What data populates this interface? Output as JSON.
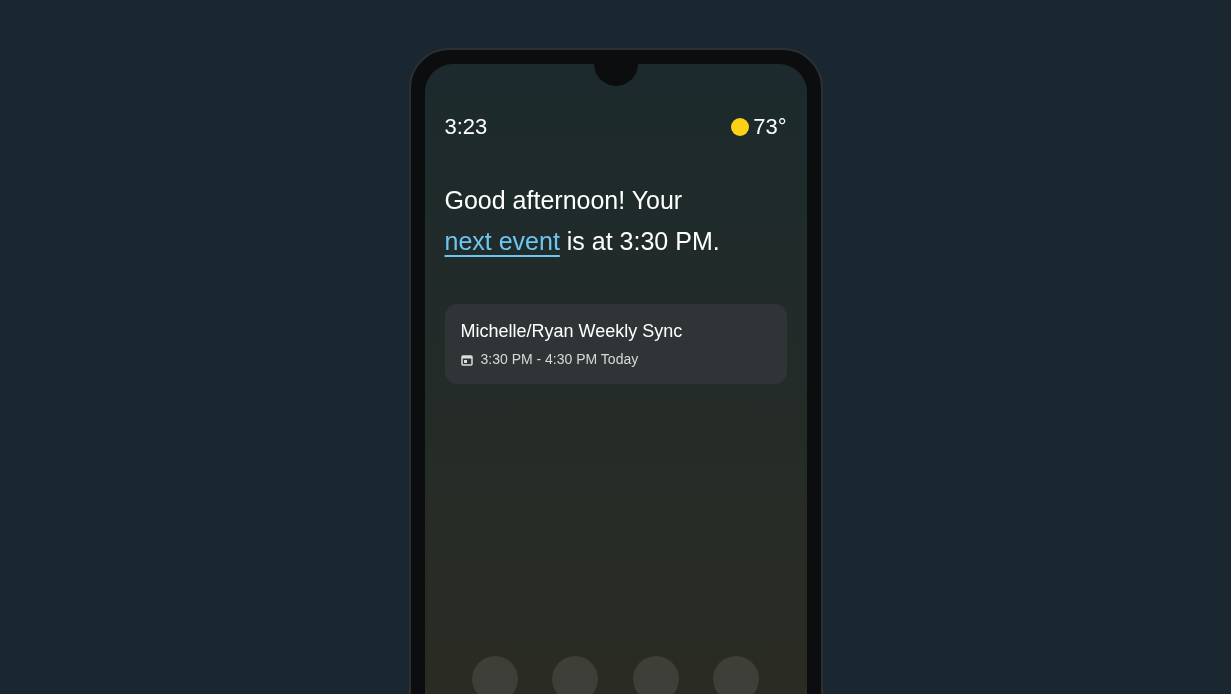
{
  "status": {
    "time": "3:23",
    "temperature": "73°"
  },
  "greeting": {
    "before": "Good afternoon! Your",
    "link": "next event",
    "after": "is at 3:30 PM."
  },
  "event": {
    "title": "Michelle/Ryan Weekly Sync",
    "time": "3:30 PM - 4:30 PM Today"
  },
  "dock": [
    {
      "kind": "app"
    },
    {
      "kind": "app"
    },
    {
      "kind": "app"
    },
    {
      "kind": "app"
    }
  ]
}
